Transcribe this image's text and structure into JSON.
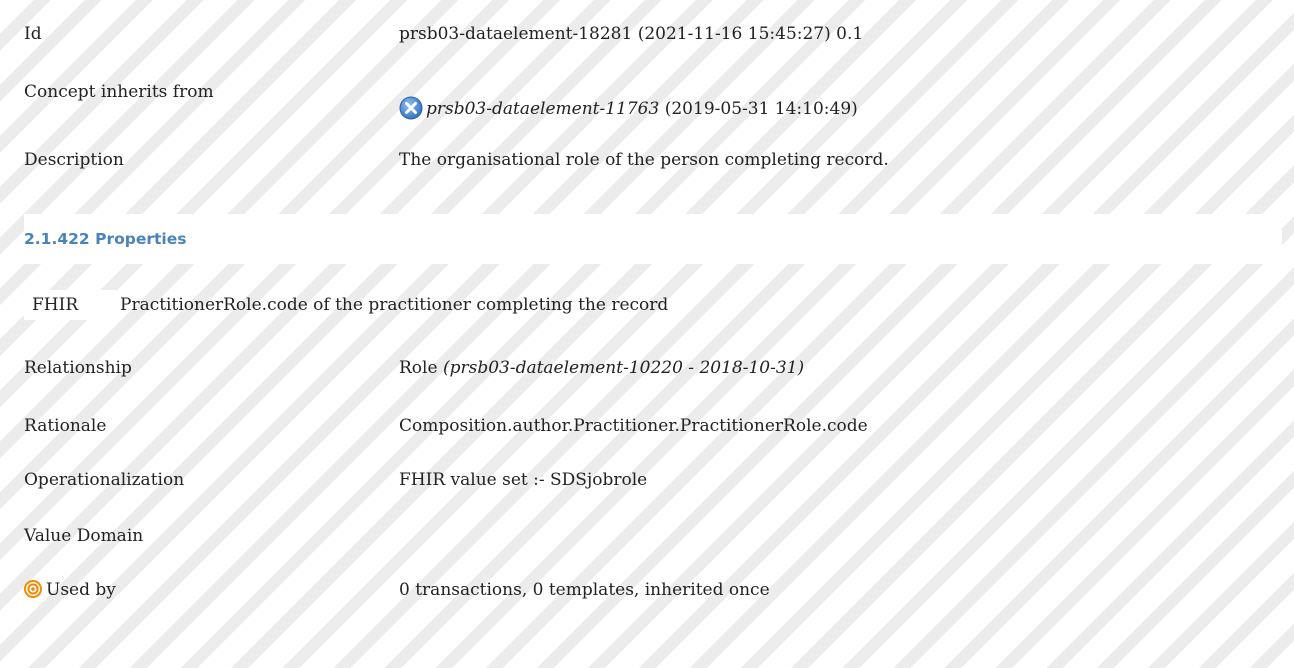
{
  "id_row": {
    "label": "Id",
    "value": "prsb03-dataelement-18281 (2021-11-16 15:45:27) 0.1"
  },
  "inherits_row": {
    "label": "Concept inherits from",
    "ref_id": "prsb03-dataelement-11763",
    "ref_date": "(2019-05-31 14:10:49)"
  },
  "description_row": {
    "label": "Description",
    "value": "The organisational role of the person completing record."
  },
  "section": {
    "heading": "2.1.422 Properties"
  },
  "fhir": {
    "badge": "FHIR",
    "text": "PractitionerRole.code of the practitioner completing the record"
  },
  "relationship_row": {
    "label": "Relationship",
    "value": "Role",
    "ref": "(prsb03-dataelement-10220 - 2018-10-31)"
  },
  "rationale_row": {
    "label": "Rationale",
    "value": "Composition.author.Practitioner.PractitionerRole.code"
  },
  "operationalization_row": {
    "label": "Operationalization",
    "value": "FHIR value set :- SDSjobrole"
  },
  "value_domain_row": {
    "label": "Value Domain",
    "value": ""
  },
  "used_by_row": {
    "label": "Used by",
    "value": "0 transactions, 0 templates, inherited once"
  },
  "colors": {
    "heading": "#4a83bb",
    "x_icon": "#3a7fd0",
    "target_icon": "#f08a00"
  },
  "icons": {
    "inherits": "close-circle-icon",
    "used_by": "target-icon"
  }
}
